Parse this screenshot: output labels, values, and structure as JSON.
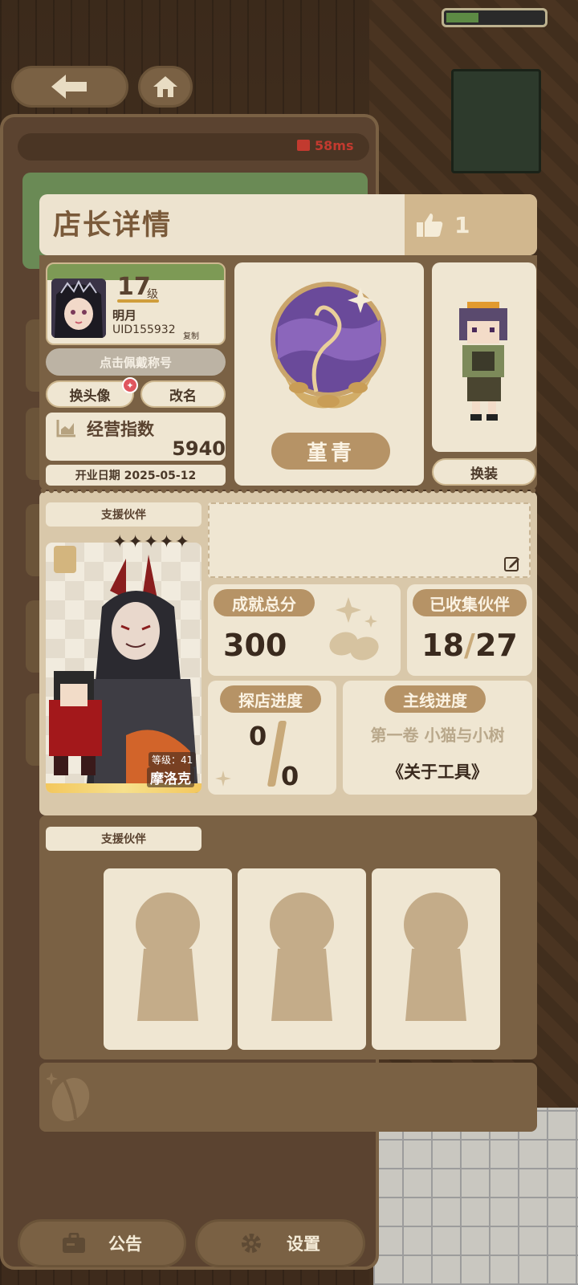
{
  "status": {
    "ping": "58ms"
  },
  "header": {
    "title": "店长详情",
    "likes": "1"
  },
  "profile": {
    "level": "17",
    "level_unit": "级",
    "name": "明月",
    "uid": "UID155932",
    "copy_label": "复制",
    "wear_title_label": "点击佩戴称号",
    "change_avatar_label": "换头像",
    "rename_label": "改名",
    "business_index_label": "经营指数",
    "business_index_value": "5940",
    "open_date": "开业日期 2025-05-12"
  },
  "emblem": {
    "label": "堇青"
  },
  "character": {
    "outfit_label": "换装"
  },
  "support": {
    "label": "支援伙伴",
    "partner_level": "等级：41",
    "partner_name": "摩洛克",
    "stars": "✦✦✦✦✦"
  },
  "stats": {
    "achievement_label": "成就总分",
    "achievement_value": "300",
    "collected_label": "已收集伙伴",
    "collected_have": "18",
    "collected_sep": "/",
    "collected_total": "27",
    "visit_label": "探店进度",
    "visit_done": "0",
    "visit_total": "0",
    "main_label": "主线进度",
    "main_chapter": "第一卷 小猫与小树",
    "main_title": "《关于工具》"
  },
  "support2": {
    "label": "支援伙伴"
  },
  "bottom": {
    "notice_label": "公告",
    "settings_label": "设置"
  },
  "colors": {
    "panel": "#7a6144",
    "card": "#efe6d2",
    "accent": "#b69366",
    "ping": "#c23a2f"
  },
  "icons": [
    "back-arrow-icon",
    "home-icon",
    "signal-icon",
    "thumbs-up-icon",
    "chart-icon",
    "edit-icon",
    "coffee-bean-icon",
    "briefcase-icon",
    "gear-icon",
    "silhouette-icon"
  ]
}
